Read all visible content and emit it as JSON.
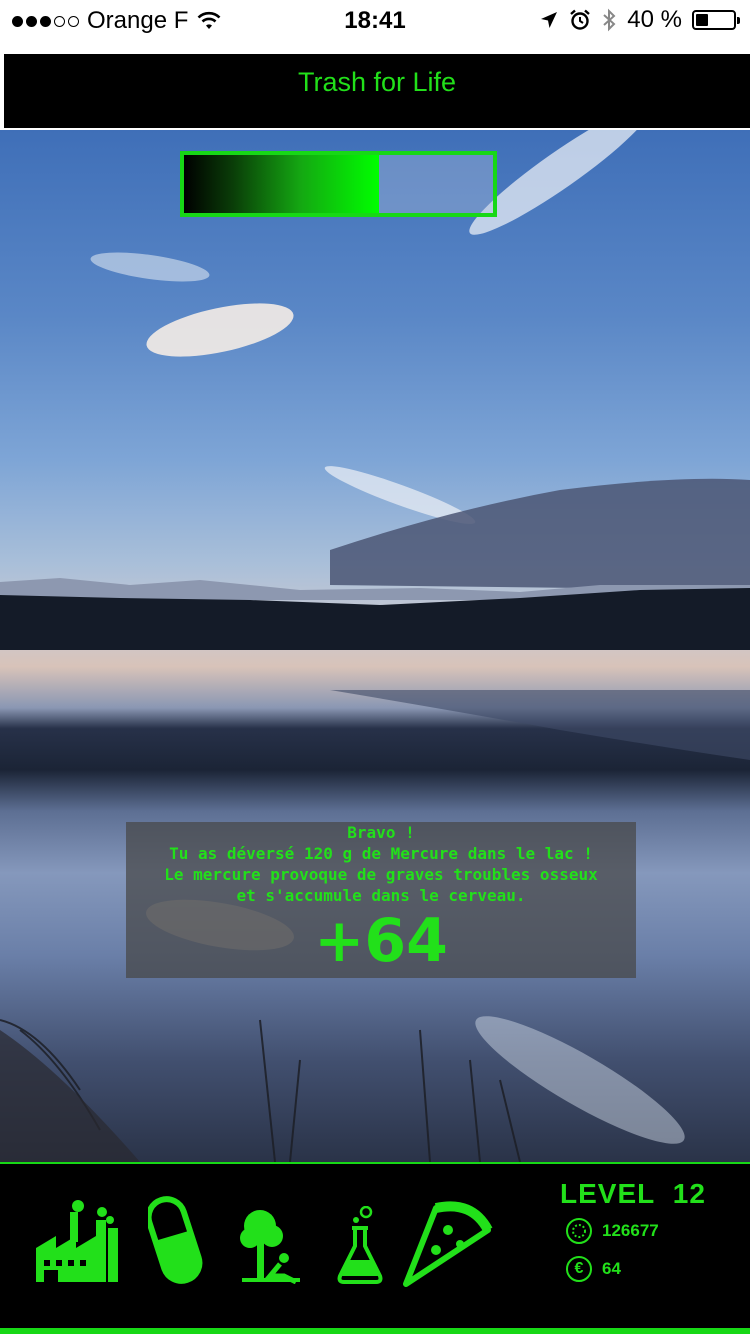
{
  "status_bar": {
    "signal_dots_filled": 3,
    "signal_dots_total": 5,
    "carrier": "Orange F",
    "time": "18:41",
    "battery_percent": "40 %",
    "battery_level": 0.4,
    "icons": [
      "wifi-icon",
      "location-arrow-icon",
      "alarm-icon",
      "bluetooth-icon",
      "battery-icon"
    ]
  },
  "header": {
    "title": "Trash for Life"
  },
  "progress": {
    "fill_fraction": 0.63
  },
  "popup": {
    "line1": "Bravo !",
    "line2": "Tu as déversé 120 g de Mercure dans le lac !",
    "line3": "Le mercure provoque de graves troubles osseux",
    "line4": "et s'accumule dans le cerveau.",
    "score": "+64"
  },
  "toolbar": {
    "items": [
      "factory-icon",
      "pill-icon",
      "tree-person-icon",
      "flask-icon",
      "pizza-icon"
    ]
  },
  "stats": {
    "level_label": "LEVEL",
    "level_value": "12",
    "trash_count": "126677",
    "money": "64"
  },
  "colors": {
    "accent": "#22e01a",
    "background": "#000000"
  }
}
